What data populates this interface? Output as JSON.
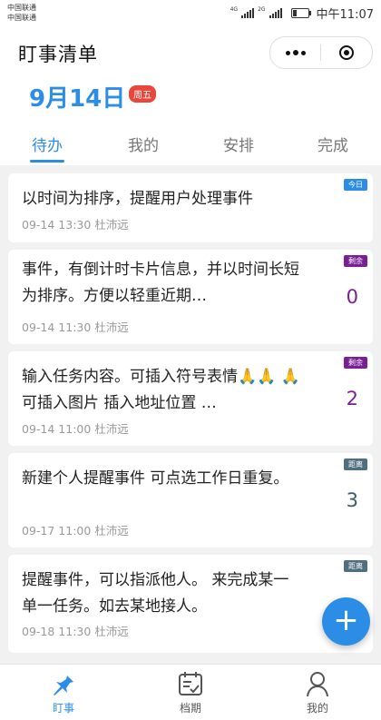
{
  "status_bar": {
    "carrier_1": "中国联通",
    "carrier_2": "中国联通",
    "net_1": "4G",
    "net_2": "2G",
    "time": "中午11:07"
  },
  "header": {
    "app_title": "盯事清单",
    "date": "9月14日",
    "weekday": "周五"
  },
  "tabs": [
    {
      "label": "待办",
      "active": true
    },
    {
      "label": "我的",
      "active": false
    },
    {
      "label": "安排",
      "active": false
    },
    {
      "label": "完成",
      "active": false
    }
  ],
  "cards": [
    {
      "title": "以时间为排序，提醒用户处理事件",
      "meta": "09-14 13:30 杜沛远",
      "badge": "今日",
      "count": ""
    },
    {
      "title": "事件，有倒计时卡片信息，并以时间长短为排序。方便以轻重近期…",
      "meta": "09-14 11:30 杜沛远",
      "badge": "剩余",
      "count": "0"
    },
    {
      "title": "输入任务内容。可插入符号表情🙏🙏 🙏 可插入图片 插入地址位置 …",
      "meta": "09-14 11:00 杜沛远",
      "badge": "剩余",
      "count": "2"
    },
    {
      "title": "新建个人提醒事件 可点选工作日重复。",
      "meta": "09-17 11:00 杜沛远",
      "badge": "距离",
      "count": "3"
    },
    {
      "title": "提醒事件，可以指派他人。 来完成某一单一任务。如去某地接人。",
      "meta": "09-18 11:30 杜沛远",
      "badge": "距离",
      "count": ""
    }
  ],
  "fab": {
    "label": "+"
  },
  "bottom_nav": [
    {
      "label": "盯事",
      "icon": "pin-icon",
      "active": true
    },
    {
      "label": "档期",
      "icon": "calendar-check-icon",
      "active": false
    },
    {
      "label": "我的",
      "icon": "user-icon",
      "active": false
    }
  ],
  "colors": {
    "accent": "#2c8de6",
    "weekday_badge": "#e8473c",
    "remaining": "#7a1f96",
    "distance": "#4f6f80"
  }
}
